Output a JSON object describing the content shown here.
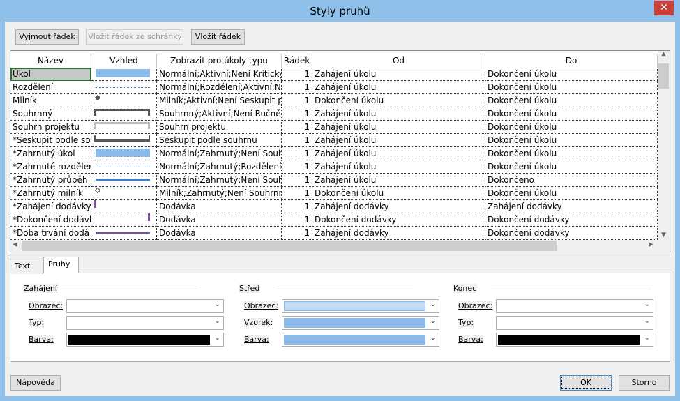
{
  "window": {
    "title": "Styly pruhů",
    "close": "✕"
  },
  "toolbar": {
    "cut_row": "Vyjmout řádek",
    "paste_row": "Vložit řádek ze schránky",
    "insert_row": "Vložit řádek"
  },
  "table": {
    "headers": [
      "Název",
      "Vzhled",
      "Zobrazit pro úkoly typu",
      "Řádek",
      "Od",
      "Do"
    ],
    "rows": [
      {
        "name": "Úkol",
        "look": "bar",
        "color": "#8ab9ea",
        "show": "Normální;Aktivní;Není Kritický;",
        "row": "1",
        "from": "Zahájení úkolu",
        "to": "Dokončení úkolu"
      },
      {
        "name": "Rozdělení",
        "look": "dotted",
        "color": "#4a7cc0",
        "show": "Normální;Rozdělení;Aktivní;Ne",
        "row": "1",
        "from": "Zahájení úkolu",
        "to": "Dokončení úkolu"
      },
      {
        "name": "Milník",
        "look": "diamond",
        "color": "#555555",
        "show": "Milník;Aktivní;Není Seskupit pc",
        "row": "1",
        "from": "Dokončení úkolu",
        "to": "Dokončení úkolu"
      },
      {
        "name": "Souhrnný",
        "look": "summary",
        "color": "#555555",
        "show": "Souhrnný;Aktivní;Není Ručně n",
        "row": "1",
        "from": "Zahájení úkolu",
        "to": "Dokončení úkolu"
      },
      {
        "name": "Souhrn projektu",
        "look": "summary",
        "color": "#bbbbbb",
        "show": "Souhrn projektu",
        "row": "1",
        "from": "Zahájení úkolu",
        "to": "Dokončení úkolu"
      },
      {
        "name": "*Seskupit podle so",
        "look": "group",
        "color": "#555555",
        "show": "Seskupit podle souhrnu",
        "row": "1",
        "from": "Zahájení úkolu",
        "to": "Dokončení úkolu"
      },
      {
        "name": "*Zahrnutý úkol",
        "look": "bar",
        "color": "#8ab9ea",
        "show": "Normální;Zahrnutý;Není Souhr",
        "row": "1",
        "from": "Zahájení úkolu",
        "to": "Dokončení úkolu"
      },
      {
        "name": "*Zahrnuté rozdělen",
        "look": "dotted",
        "color": "#4a7cc0",
        "show": "Normální;Zahrnutý;Rozdělení;N",
        "row": "1",
        "from": "Zahájení úkolu",
        "to": "Dokončení úkolu"
      },
      {
        "name": "*Zahrnutý průběh",
        "look": "line",
        "color": "#3c7fd0",
        "show": "Normální;Zahrnutý;Není Souhr",
        "row": "1",
        "from": "Zahájení úkolu",
        "to": "Dokončeno"
      },
      {
        "name": "*Zahrnutý milník",
        "look": "diamond-open",
        "color": "#333333",
        "show": "Milník;Zahrnutý;Není Souhrnný",
        "row": "1",
        "from": "Dokončení úkolu",
        "to": "Dokončení úkolu"
      },
      {
        "name": "*Zahájení dodávky",
        "look": "tick-left",
        "color": "#7a4f9a",
        "show": "Dodávka",
        "row": "1",
        "from": "Zahájení dodávky",
        "to": "Zahájení dodávky"
      },
      {
        "name": "*Dokončení dodávl",
        "look": "tick-right",
        "color": "#7a4f9a",
        "show": "Dodávka",
        "row": "1",
        "from": "Dokončení dodávky",
        "to": "Dokončení dodávky"
      },
      {
        "name": "*Doba trvání dodá",
        "look": "thin-line",
        "color": "#7a4f9a",
        "show": "Dodávka",
        "row": "1",
        "from": "Zahájení dodávky",
        "to": "Dokončení dodávky"
      }
    ]
  },
  "tabs": [
    {
      "label": "Text",
      "active": false
    },
    {
      "label": "Pruhy",
      "active": true
    }
  ],
  "groups": [
    {
      "title": "Zahájení",
      "fields": [
        {
          "label": "Obrazec:",
          "value": ""
        },
        {
          "label": "Typ:",
          "value": ""
        },
        {
          "label": "Barva:",
          "value": "#000000"
        }
      ]
    },
    {
      "title": "Střed",
      "fields": [
        {
          "label": "Obrazec:",
          "value": "#c5ddf4"
        },
        {
          "label": "Vzorek:",
          "value": "#8ab9ea"
        },
        {
          "label": "Barva:",
          "value": "#8ab9ea"
        }
      ]
    },
    {
      "title": "Konec",
      "fields": [
        {
          "label": "Obrazec:",
          "value": ""
        },
        {
          "label": "Typ:",
          "value": ""
        },
        {
          "label": "Barva:",
          "value": "#000000"
        }
      ]
    }
  ],
  "footer": {
    "help": "Nápověda",
    "ok": "OK",
    "cancel": "Storno"
  }
}
